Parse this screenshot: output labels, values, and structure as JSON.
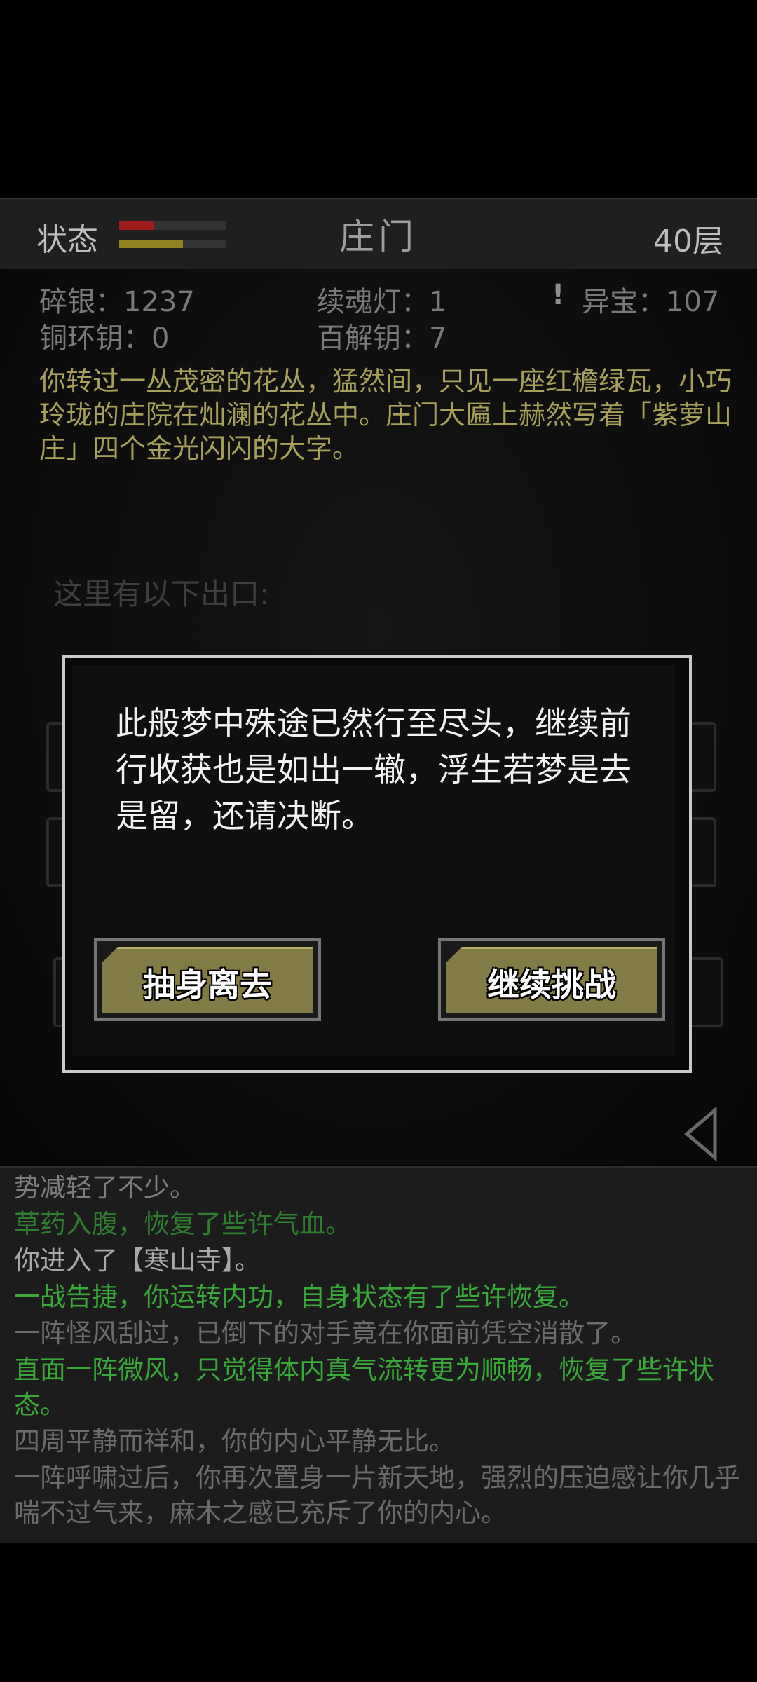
{
  "header": {
    "status_label": "状态",
    "hp_fraction": 0.33,
    "qi_fraction": 0.6,
    "hp_color": "#a01c1c",
    "qi_color": "#8f8320",
    "title": "庄门",
    "floor": "40层"
  },
  "stats": {
    "silver": "碎银：1237",
    "soul_lamp": "续魂灯：1",
    "treasure": "异宝：107",
    "warning": "!",
    "bronze_key": "铜环钥：0",
    "master_key": "百解钥：7"
  },
  "story": "你转过一丛茂密的花丛，猛然间，只见一座红檐绿瓦，小巧玲珑的庄院在灿澜的花丛中。庄门大匾上赫然写着「紫萝山庄」四个金光闪闪的大字。",
  "exits_label": "这里有以下出口:",
  "modal": {
    "message": "此般梦中殊途已然行至尽头，继续前行收获也是如出一辙，浮生若梦是去是留，还请决断。",
    "leave_label": "抽身离去",
    "continue_label": "继续挑战"
  },
  "log": [
    {
      "text": "势减轻了不少。",
      "color": "#7d7d7d"
    },
    {
      "text": "草药入腹，恢复了些许气血。",
      "color": "#2f7d2f"
    },
    {
      "text": "你进入了【寒山寺】。",
      "color": "#a9a9a9"
    },
    {
      "text": "一战告捷，你运转内功，自身状态有了些许恢复。",
      "color": "#38a838"
    },
    {
      "text": "一阵怪风刮过，已倒下的对手竟在你面前凭空消散了。",
      "color": "#6b6b6b"
    },
    {
      "text": "直面一阵微风，只觉得体内真气流转更为顺畅，恢复了些许状态。",
      "color": "#38a838"
    },
    {
      "text": "四周平静而祥和，你的内心平静无比。",
      "color": "#6b6b6b"
    },
    {
      "text": "一阵呼啸过后，你再次置身一片新天地，强烈的压迫感让你几乎喘不过气来，麻木之感已充斥了你的内心。",
      "color": "#6b6b6b"
    }
  ]
}
